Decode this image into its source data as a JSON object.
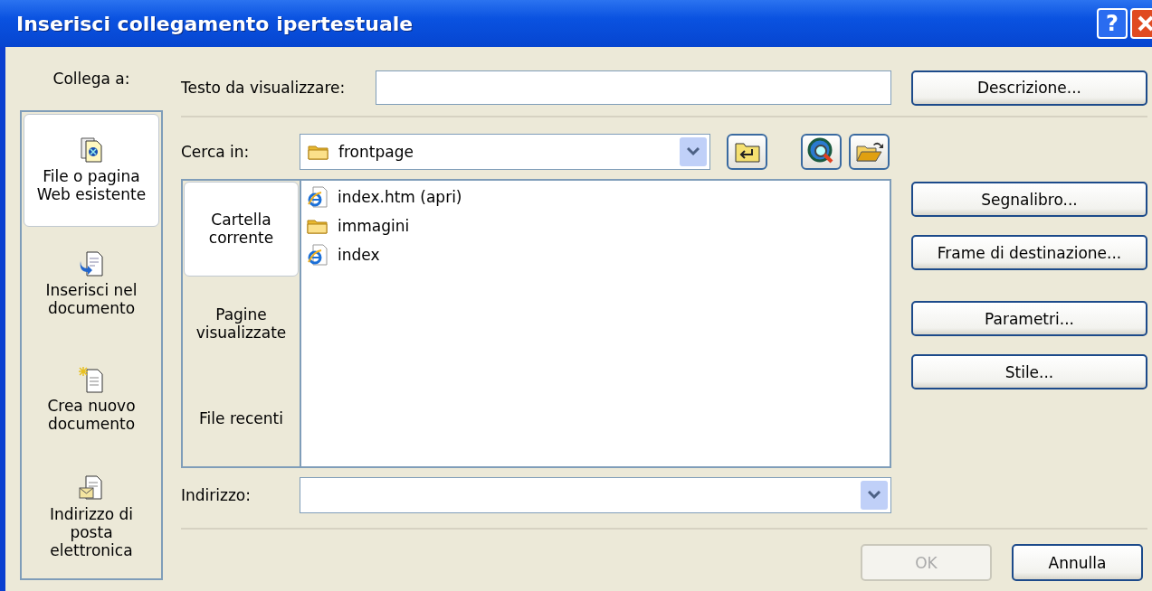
{
  "window": {
    "title": "Inserisci collegamento ipertestuale",
    "help": "?"
  },
  "link_to": {
    "label": "Collega a:",
    "items": [
      {
        "label": "File o pagina\nWeb esistente",
        "kind": "existing",
        "selected": true
      },
      {
        "label": "Inserisci nel\ndocumento",
        "kind": "place",
        "selected": false
      },
      {
        "label": "Crea nuovo\ndocumento",
        "kind": "new",
        "selected": false
      },
      {
        "label": "Indirizzo di\nposta\nelettronica",
        "kind": "email",
        "selected": false
      }
    ]
  },
  "display_text": {
    "label": "Testo da visualizzare:"
  },
  "description_button": "Descrizione...",
  "look_in": {
    "label": "Cerca in:",
    "value": "frontpage"
  },
  "view_tabs": [
    {
      "label": "Cartella\ncorrente",
      "selected": true
    },
    {
      "label": "Pagine\nvisualizzate",
      "selected": false
    },
    {
      "label": "File recenti",
      "selected": false
    }
  ],
  "files": [
    {
      "name": "index.htm (apri)",
      "kind": "page"
    },
    {
      "name": "immagini",
      "kind": "folder"
    },
    {
      "name": "index",
      "kind": "page"
    }
  ],
  "address": {
    "label": "Indirizzo:"
  },
  "side_buttons": [
    [
      "Segnalibro...",
      "Frame di destinazione..."
    ],
    [
      "Parametri...",
      "Stile..."
    ]
  ],
  "footer_buttons": [
    {
      "label": "OK",
      "disabled": true
    },
    {
      "label": "Annulla",
      "disabled": false
    }
  ]
}
